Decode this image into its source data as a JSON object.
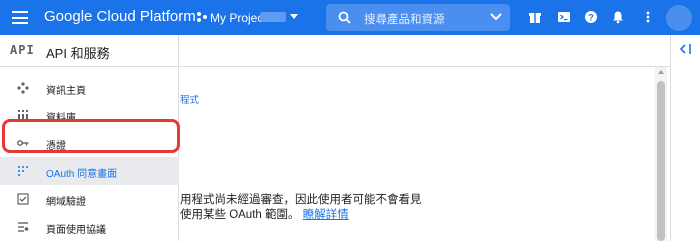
{
  "header": {
    "brand": "Google Cloud Platform",
    "project": "My Project",
    "search_placeholder": "搜尋產品和資源",
    "brand_color": "#1a73e8"
  },
  "sidebar": {
    "logo": "API",
    "title": "API 和服務",
    "items": [
      {
        "label": "資訊主頁",
        "icon": "dashboard-icon"
      },
      {
        "label": "資料庫",
        "icon": "library-icon"
      },
      {
        "label": "憑證",
        "icon": "key-icon"
      },
      {
        "label": "OAuth 同意畫面",
        "icon": "oauth-consent-icon",
        "active": true
      },
      {
        "label": "網域驗證",
        "icon": "checkbox-icon"
      },
      {
        "label": "頁面使用協議",
        "icon": "settings-list-icon"
      }
    ]
  },
  "main": {
    "link_fragment": "程式",
    "text_line1": "用程式尚未經過審查，因此使用者可能不會看見",
    "text_line2_prefix": "使用某些 OAuth 範圍。",
    "text_line2_link": "瞭解詳情"
  }
}
